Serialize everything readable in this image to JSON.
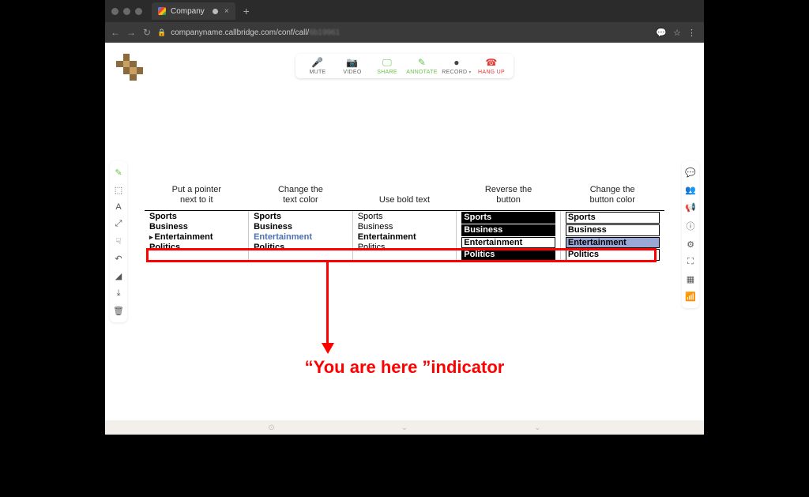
{
  "browser": {
    "tab_title": "Company",
    "url_host": "companyname.callbridge.com",
    "url_path": "/conf/call/",
    "url_blurred": "6b19961"
  },
  "toolbar": {
    "mute": "MUTE",
    "video": "VIDEO",
    "share": "SHARE",
    "annotate": "ANNOTATE",
    "record": "RECORD",
    "hangup": "HANG UP"
  },
  "headers": {
    "col1_l1": "Put a pointer",
    "col1_l2": "next to it",
    "col2_l1": "Change the",
    "col2_l2": "text color",
    "col3": "Use bold text",
    "col4_l1": "Reverse the",
    "col4_l2": "button",
    "col5_l1": "Change the",
    "col5_l2": "button color"
  },
  "items": {
    "sports": "Sports",
    "business": "Business",
    "entertainment": "Entertainment",
    "politics": "Politics"
  },
  "caption": "“You are here ”indicator"
}
